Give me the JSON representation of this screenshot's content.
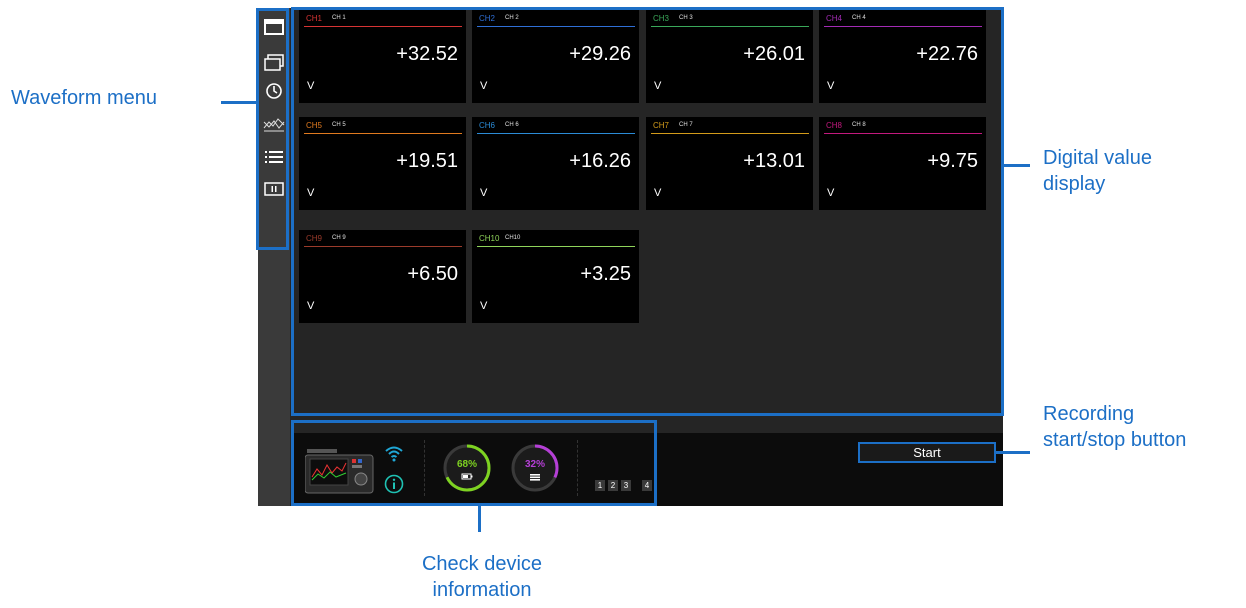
{
  "sidebar": {
    "items": [
      {
        "icon": "panel-icon"
      },
      {
        "icon": "windows-icon"
      },
      {
        "icon": "clock-icon"
      },
      {
        "icon": "waveform-icon"
      },
      {
        "icon": "list-icon"
      },
      {
        "icon": "pause-icon"
      }
    ]
  },
  "channels": [
    {
      "id": "CH1",
      "name": "CH 1",
      "value": "+32.52",
      "unit": "V",
      "color": "#d73434"
    },
    {
      "id": "CH2",
      "name": "CH 2",
      "value": "+29.26",
      "unit": "V",
      "color": "#2f6fd6"
    },
    {
      "id": "CH3",
      "name": "CH 3",
      "value": "+26.01",
      "unit": "V",
      "color": "#3aa85a"
    },
    {
      "id": "CH4",
      "name": "CH 4",
      "value": "+22.76",
      "unit": "V",
      "color": "#a32bb5"
    },
    {
      "id": "CH5",
      "name": "CH 5",
      "value": "+19.51",
      "unit": "V",
      "color": "#e07a1f"
    },
    {
      "id": "CH6",
      "name": "CH 6",
      "value": "+16.26",
      "unit": "V",
      "color": "#2b8bd6"
    },
    {
      "id": "CH7",
      "name": "CH 7",
      "value": "+13.01",
      "unit": "V",
      "color": "#d39b1a"
    },
    {
      "id": "CH8",
      "name": "CH 8",
      "value": "+9.75",
      "unit": "V",
      "color": "#c2197e"
    },
    {
      "id": "CH9",
      "name": "CH 9",
      "value": "+6.50",
      "unit": "V",
      "color": "#9c3b2b"
    },
    {
      "id": "CH10",
      "name": "CH10",
      "value": "+3.25",
      "unit": "V",
      "color": "#8fd45a"
    }
  ],
  "status": {
    "battery_percent": 68,
    "battery_label": "68%",
    "battery_color": "#7ed321",
    "storage_percent": 32,
    "storage_label": "32%",
    "storage_color": "#b53fd6",
    "pages": [
      "1",
      "2",
      "3",
      "4"
    ]
  },
  "controls": {
    "start_label": "Start"
  },
  "annotations": {
    "waveform_menu": "Waveform menu",
    "digital_value_line1": "Digital value",
    "digital_value_line2": "display",
    "recording_line1": "Recording",
    "recording_line2": "start/stop button",
    "device_info_line1": "Check device",
    "device_info_line2": "information"
  },
  "colors": {
    "accent": "#1c6fc6",
    "wifi": "#1fa7d6",
    "info": "#1fc2b4"
  }
}
